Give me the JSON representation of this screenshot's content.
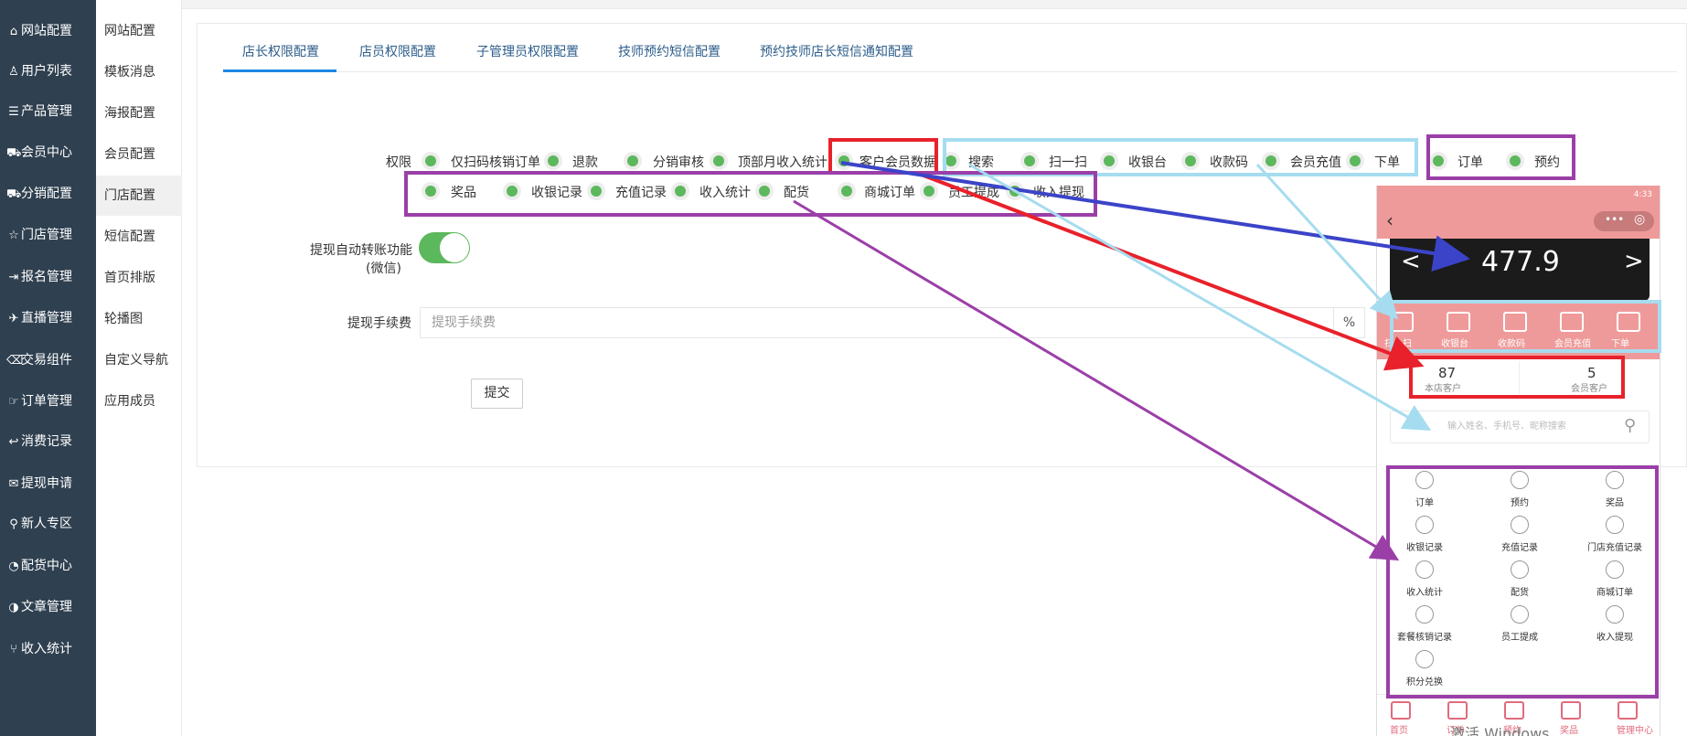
{
  "sidebar": {
    "items": [
      {
        "label": "网站配置",
        "icon": "home-icon",
        "glyph": "⌂"
      },
      {
        "label": "用户列表",
        "icon": "user-icon",
        "glyph": "♙"
      },
      {
        "label": "产品管理",
        "icon": "server-icon",
        "glyph": "☰"
      },
      {
        "label": "会员中心",
        "icon": "cart-icon",
        "glyph": "⛟"
      },
      {
        "label": "分销配置",
        "icon": "cart-icon",
        "glyph": "⛟"
      },
      {
        "label": "门店管理",
        "icon": "star-icon",
        "glyph": "☆"
      },
      {
        "label": "报名管理",
        "icon": "sign-in-icon",
        "glyph": "⇥"
      },
      {
        "label": "直播管理",
        "icon": "plane-icon",
        "glyph": "✈"
      },
      {
        "label": "交易组件",
        "icon": "eraser-icon",
        "glyph": "⌫"
      },
      {
        "label": "订单管理",
        "icon": "hand-icon",
        "glyph": "☞"
      },
      {
        "label": "消费记录",
        "icon": "reply-icon",
        "glyph": "↩"
      },
      {
        "label": "提现申请",
        "icon": "comments-icon",
        "glyph": "✉"
      },
      {
        "label": "新人专区",
        "icon": "map-marker-icon",
        "glyph": "⚲"
      },
      {
        "label": "配货中心",
        "icon": "pie-chart-icon",
        "glyph": "◔"
      },
      {
        "label": "文章管理",
        "icon": "adjust-icon",
        "glyph": "◑"
      },
      {
        "label": "收入统计",
        "icon": "code-fork-icon",
        "glyph": "⑂"
      }
    ]
  },
  "submenu": {
    "items": [
      "网站配置",
      "模板消息",
      "海报配置",
      "会员配置",
      "门店配置",
      "短信配置",
      "首页排版",
      "轮播图",
      "自定义导航",
      "应用成员"
    ],
    "active_index": 4
  },
  "tabs": [
    "店长权限配置",
    "店员权限配置",
    "子管理员权限配置",
    "技师预约短信配置",
    "预约技师店长短信通知配置"
  ],
  "form": {
    "permission_label": "权限",
    "options_row1": [
      "仅扫码核销订单",
      "退款",
      "分销审核",
      "顶部月收入统计",
      "客户会员数据",
      "搜索",
      "扫一扫",
      "收银台",
      "收款码",
      "会员充值",
      "下单",
      "订单",
      "预约"
    ],
    "options_row2": [
      "奖品",
      "收银记录",
      "充值记录",
      "收入统计",
      "配货",
      "商城订单",
      "员工提成",
      "收入提现"
    ],
    "withdraw_auto_label": "提现自动转账功能",
    "withdraw_auto_sub": "(微信)",
    "withdraw_auto_enabled": true,
    "fee_label": "提现手续费",
    "fee_placeholder": "提现手续费",
    "fee_unit": "%",
    "submit_label": "提交"
  },
  "colors": {
    "sidebar_bg": "#2f4050",
    "check_green": "#5cb85c",
    "accent_blue": "#1e88e5",
    "annot_red": "#e8212b",
    "annot_cyan": "#a6dcef",
    "annot_purple": "#9b3fa8",
    "annot_blue": "#3b44c8"
  },
  "phone": {
    "status_time": "4:33",
    "amount": "477.9",
    "prev": "<",
    "next": ">",
    "quick_actions": [
      "扫一扫",
      "收银台",
      "收款码",
      "会员充值",
      "下单"
    ],
    "stats": [
      {
        "value": "87",
        "caption": "本店客户"
      },
      {
        "value": "5",
        "caption": "会员客户"
      }
    ],
    "search_placeholder": "输入姓名、手机号、昵称搜索",
    "grid": [
      "订单",
      "预约",
      "奖品",
      "收银记录",
      "充值记录",
      "门店充值记录",
      "收入统计",
      "配货",
      "商城订单",
      "套餐核销记录",
      "员工提成",
      "收入提现",
      "积分兑换"
    ],
    "tabbar": [
      "首页",
      "订单",
      "预约",
      "奖品",
      "管理中心"
    ],
    "watermark": "激活 Windows"
  }
}
